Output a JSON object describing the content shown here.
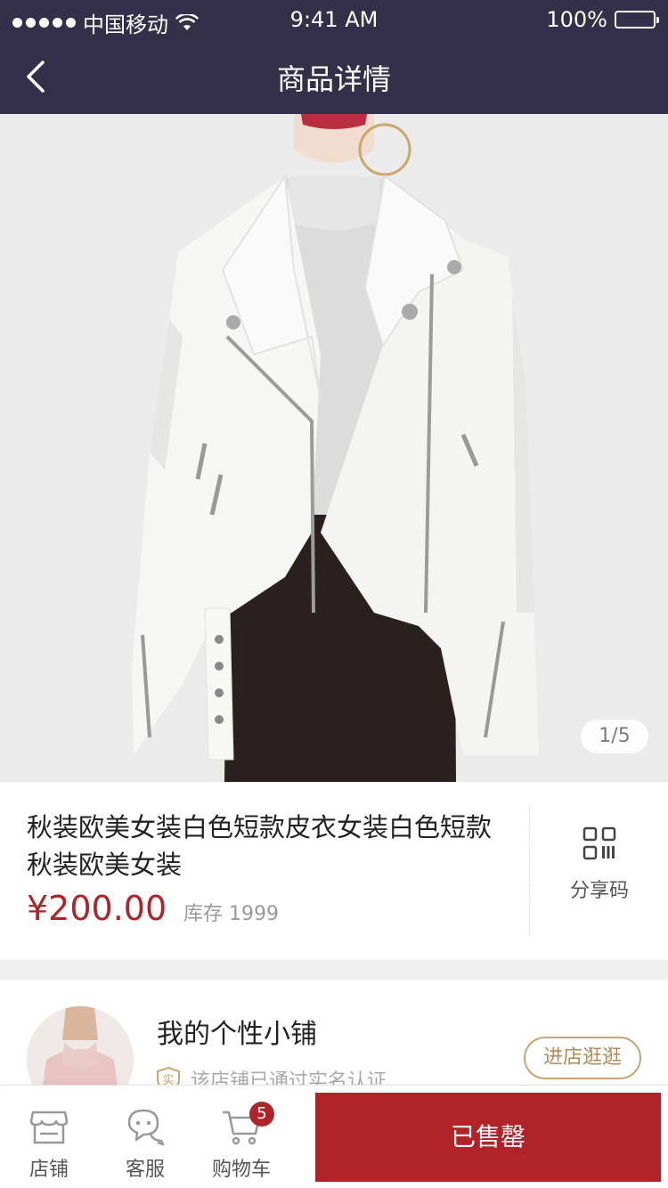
{
  "status_bar": {
    "carrier": "中国移动",
    "time": "9:41 AM",
    "battery": "100%"
  },
  "nav": {
    "title": "商品详情",
    "back_icon": "chevron-left-icon"
  },
  "gallery": {
    "pager": "1/5",
    "image_subject": "white leather moto jacket"
  },
  "product": {
    "name": "秋装欧美女装白色短款皮衣女装白色短款秋装欧美女装",
    "price": "¥200.00",
    "stock": "库存 1999",
    "share_label": "分享码",
    "share_icon": "qr-code-icon"
  },
  "shop": {
    "name": "我的个性小铺",
    "verify_badge": "实",
    "verify_text": "该店铺已通过实名认证",
    "visit_button": "进店逛逛"
  },
  "bottom_bar": {
    "tabs": [
      {
        "label": "店铺",
        "icon": "store-icon"
      },
      {
        "label": "客服",
        "icon": "chat-icon"
      },
      {
        "label": "购物车",
        "icon": "cart-icon",
        "badge": "5"
      }
    ],
    "primary_button": "已售罄"
  },
  "colors": {
    "header_bg": "#35304a",
    "accent_red": "#b02329",
    "gold": "#c9a673"
  }
}
